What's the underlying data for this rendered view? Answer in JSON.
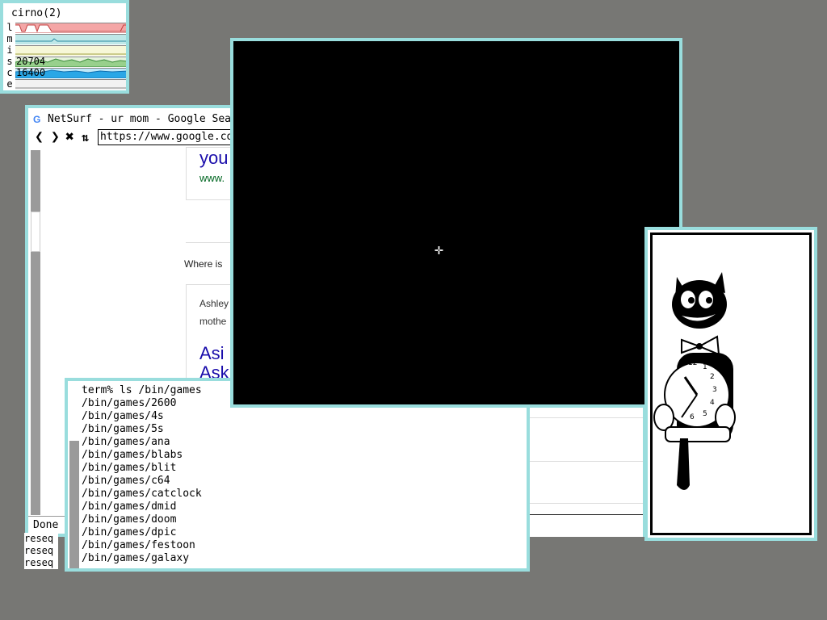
{
  "stats": {
    "title": "cirno(2)",
    "rows": [
      {
        "label": "l",
        "value": "",
        "color": "#f4a6a6"
      },
      {
        "label": "m",
        "value": "",
        "color": "#bfe8e8"
      },
      {
        "label": "i",
        "value": "",
        "color": "#f7f7d8"
      },
      {
        "label": "s",
        "value": "20704",
        "color": "#98d08c"
      },
      {
        "label": "c",
        "value": "16400",
        "color": "#2aa7e6"
      },
      {
        "label": "e",
        "value": "",
        "color": "#e8e8e8"
      }
    ]
  },
  "netsurf": {
    "title": "NetSurf - ur mom - Google Sea",
    "url": "https://www.google.co",
    "status": "Done",
    "content": {
      "result_heading": "you",
      "result_link": "www.",
      "where_text": "Where is",
      "snippet_line1": "Ashley",
      "snippet_line2": "mothe",
      "heading2": "Asi",
      "heading2_cont": "Ask"
    }
  },
  "terminal": {
    "lines": [
      "term% ls /bin/games",
      "/bin/games/2600",
      "/bin/games/4s",
      "/bin/games/5s",
      "/bin/games/ana",
      "/bin/games/blabs",
      "/bin/games/blit",
      "/bin/games/c64",
      "/bin/games/catclock",
      "/bin/games/dmid",
      "/bin/games/doom",
      "/bin/games/dpic",
      "/bin/games/festoon",
      "/bin/games/galaxy"
    ]
  },
  "reseq": [
    "reseq",
    "reseq",
    "reseq"
  ],
  "catclock": {
    "numbers": [
      "12",
      "1",
      "2",
      "3",
      "4",
      "5",
      "6"
    ]
  },
  "colors": {
    "desktop": "#777774",
    "window_border": "#99dddd",
    "link_blue": "#1a0dab"
  }
}
